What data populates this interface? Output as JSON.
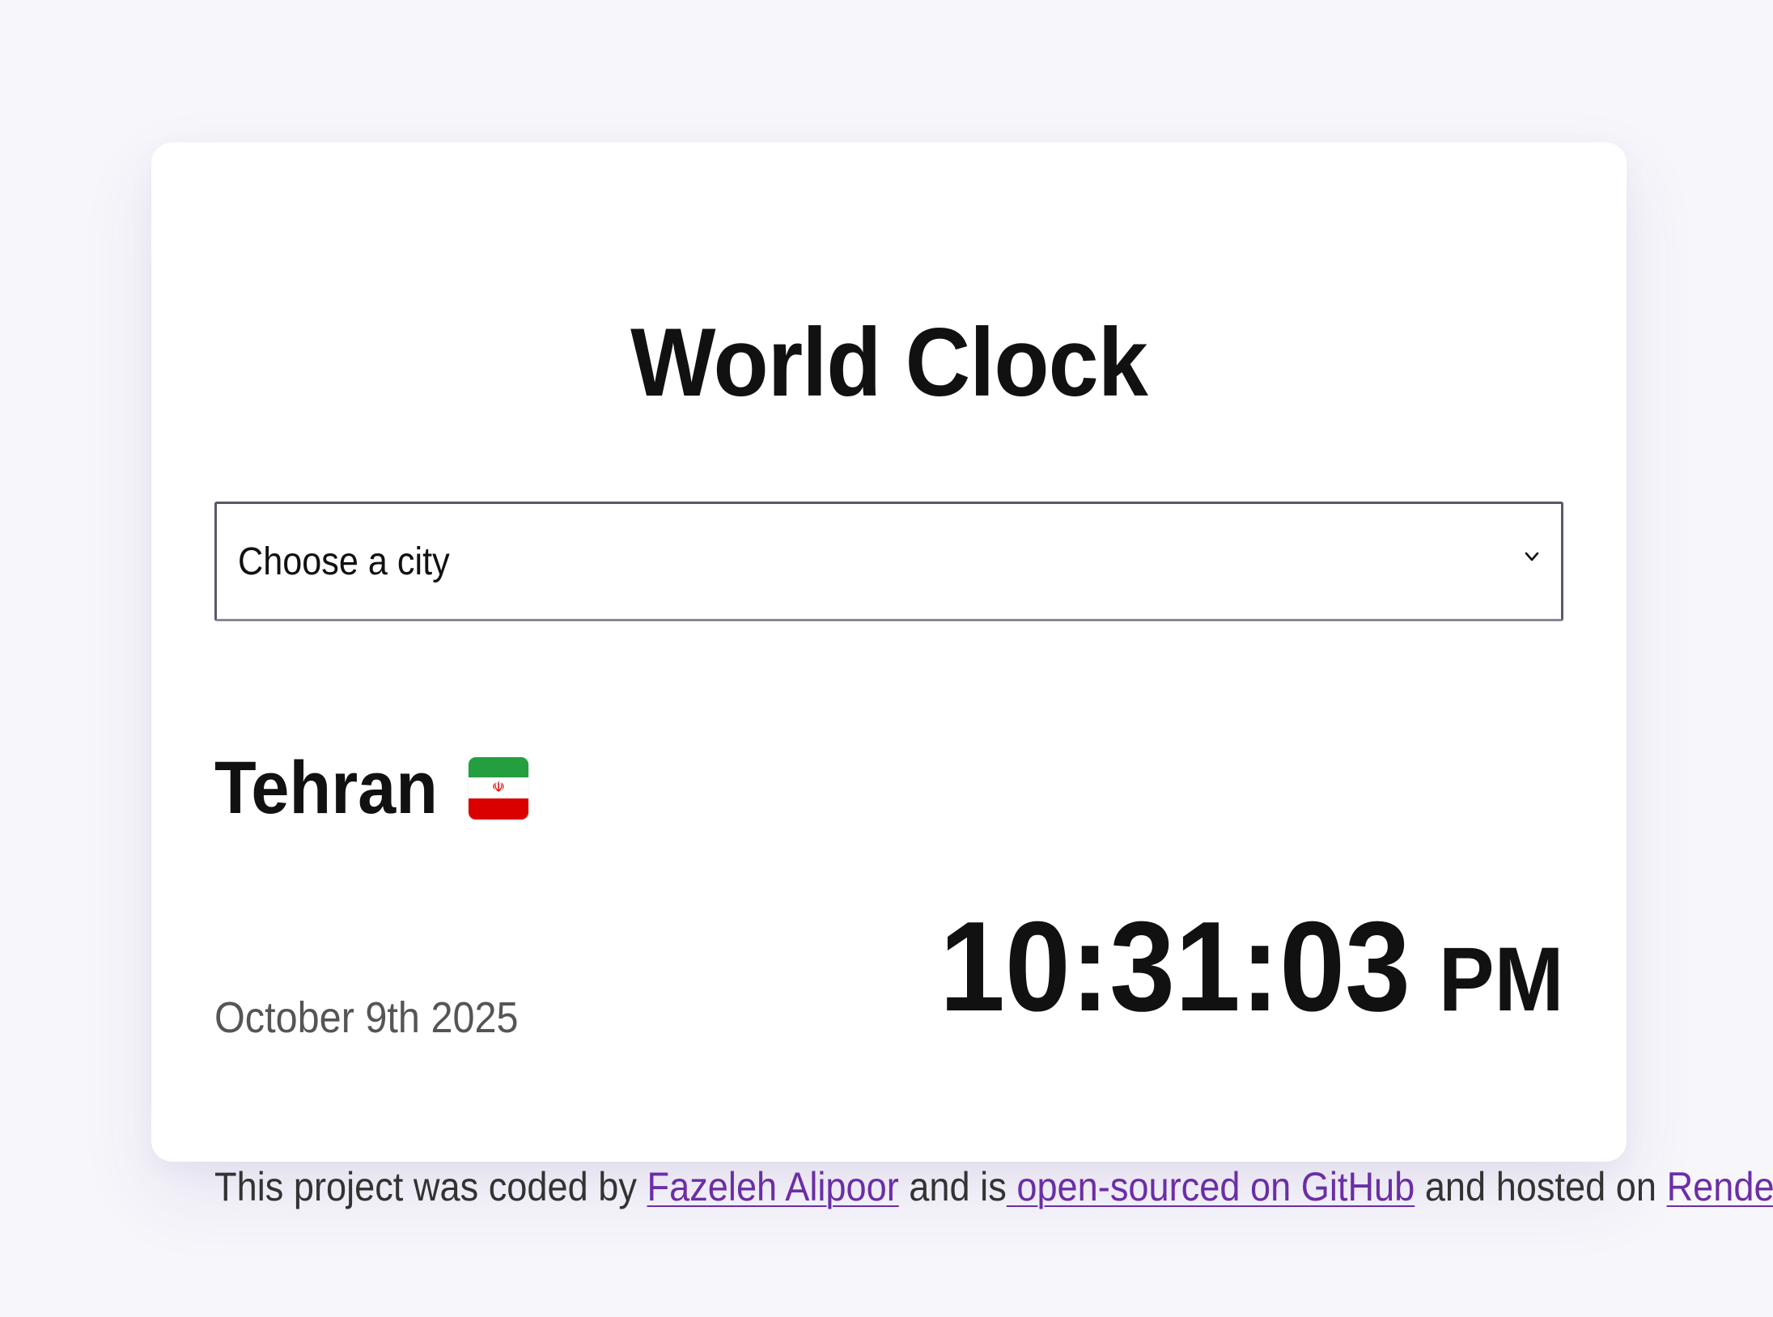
{
  "page": {
    "title": "World Clock"
  },
  "city_select": {
    "selected_label": "Choose a city"
  },
  "city": {
    "name": "Tehran",
    "flag_icon": "iran-flag-icon",
    "date": "October 9th 2025",
    "time": "10:31:03",
    "ampm": "PM"
  },
  "footer": {
    "text_1": "This project was coded by ",
    "author_link": "Fazeleh Alipoor",
    "text_2": " and is",
    "github_link": " open-sourced on GitHub",
    "text_3": " and hosted on ",
    "hosting_link": "Render",
    "text_4": "."
  },
  "colors": {
    "page_background": "#f7f6fb",
    "card_background": "#ffffff",
    "link": "#6b2ea6",
    "text_primary": "#111111",
    "text_secondary": "#555555"
  }
}
